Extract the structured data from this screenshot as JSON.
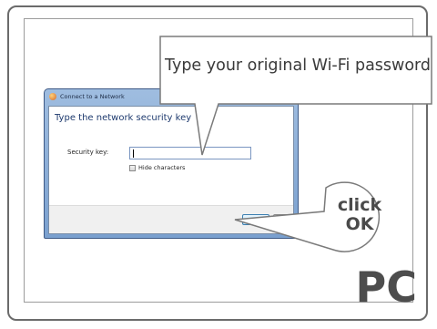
{
  "dialog": {
    "title": "Connect to a Network",
    "heading": "Type the network security key",
    "security_key_label": "Security key:",
    "security_key_value": "",
    "hide_characters_label": "Hide characters",
    "hide_characters_checked": false,
    "ok_label": "OK"
  },
  "callouts": {
    "instruction": "Type your original Wi-Fi password",
    "click_line1": "click",
    "click_line2": "OK"
  },
  "platform_label": "PC"
}
